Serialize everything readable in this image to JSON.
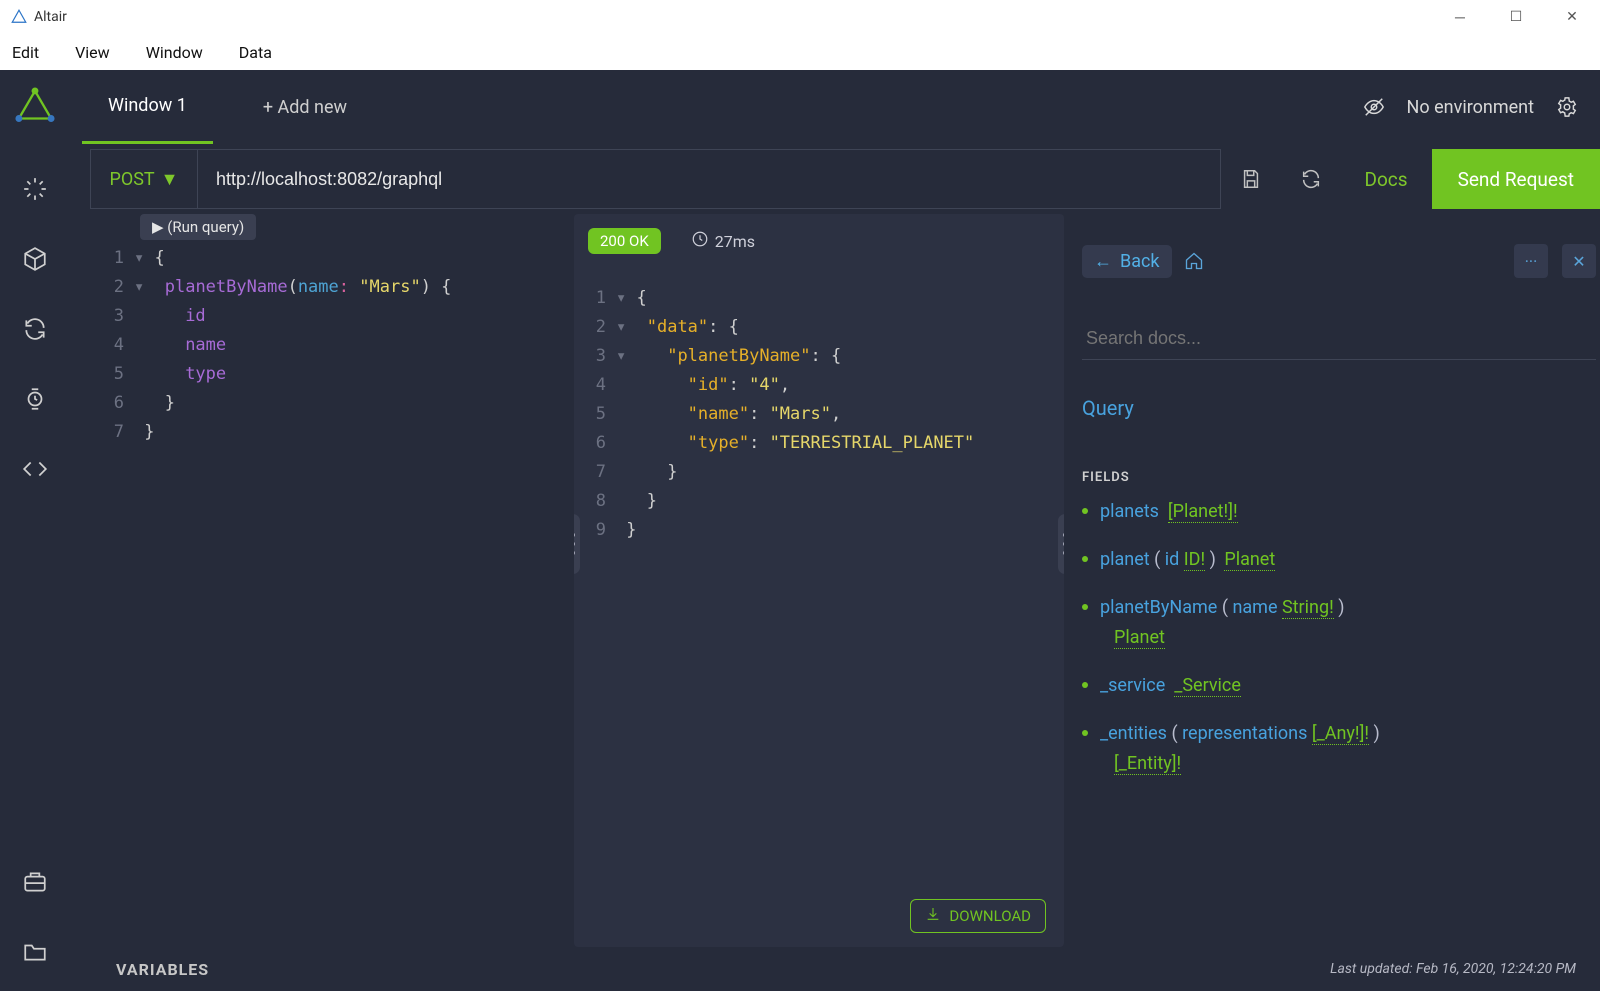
{
  "window": {
    "title": "Altair"
  },
  "menu": [
    "Edit",
    "View",
    "Window",
    "Data"
  ],
  "tabs": {
    "active": "Window 1",
    "add_label": "+ Add new"
  },
  "env": {
    "label": "No environment"
  },
  "request": {
    "method": "POST",
    "url": "http://localhost:8082/graphql",
    "docs_btn": "Docs",
    "send_btn": "Send Request",
    "run_badge": "▶ (Run query)"
  },
  "query_lines": [
    {
      "n": 1,
      "html": "<span class='caret'>▾</span><span class='tok-brace'> {</span>"
    },
    {
      "n": 2,
      "html": "<span class='caret'>▾</span>  <span class='tok-call'>planetByName</span><span class='tok-brace'>(</span><span class='tok-arg'>name</span><span class='tok-colon'>:</span> <span class='tok-str'>\"Mars\"</span><span class='tok-brace'>) {</span>"
    },
    {
      "n": 3,
      "html": "     <span class='tok-field'>id</span>"
    },
    {
      "n": 4,
      "html": "     <span class='tok-field'>name</span>"
    },
    {
      "n": 5,
      "html": "     <span class='tok-field'>type</span>"
    },
    {
      "n": 6,
      "html": "   <span class='tok-brace'>}</span>"
    },
    {
      "n": 7,
      "html": " <span class='tok-brace'>}</span>"
    }
  ],
  "response": {
    "status": "200 OK",
    "duration": "27ms",
    "download": "DOWNLOAD"
  },
  "response_lines": [
    {
      "n": 1,
      "html": "<span class='caret'>▾</span><span class='tok-brace'> {</span>"
    },
    {
      "n": 2,
      "html": "<span class='caret'>▾</span>  <span class='tok-key'>\"data\"</span>: <span class='tok-brace'>{</span>"
    },
    {
      "n": 3,
      "html": "<span class='caret'>▾</span>    <span class='tok-key'>\"planetByName\"</span>: <span class='tok-brace'>{</span>"
    },
    {
      "n": 4,
      "html": "       <span class='tok-key'>\"id\"</span>: <span class='tok-str'>\"4\"</span>,"
    },
    {
      "n": 5,
      "html": "       <span class='tok-key'>\"name\"</span>: <span class='tok-str'>\"Mars\"</span>,"
    },
    {
      "n": 6,
      "html": "       <span class='tok-key'>\"type\"</span>: <span class='tok-str'>\"TERRESTRIAL_PLANET\"</span>"
    },
    {
      "n": 7,
      "html": "     <span class='tok-brace'>}</span>"
    },
    {
      "n": 8,
      "html": "   <span class='tok-brace'>}</span>"
    },
    {
      "n": 9,
      "html": " <span class='tok-brace'>}</span>"
    }
  ],
  "docs": {
    "back": "Back",
    "search_placeholder": "Search docs...",
    "title": "Query",
    "fields_label": "FIELDS",
    "fields": [
      {
        "name": "planets",
        "args": [],
        "return": "[Planet!]!"
      },
      {
        "name": "planet",
        "args": [
          {
            "name": "id",
            "type": "ID!"
          }
        ],
        "return": "Planet"
      },
      {
        "name": "planetByName",
        "args": [
          {
            "name": "name",
            "type": "String!"
          }
        ],
        "return": "Planet"
      },
      {
        "name": "_service",
        "args": [],
        "return": "_Service"
      },
      {
        "name": "_entities",
        "args": [
          {
            "name": "representations",
            "type": "[_Any!]!"
          }
        ],
        "return": "[_Entity]!"
      }
    ]
  },
  "footer": {
    "variables": "VARIABLES",
    "updated": "Last updated: Feb 16, 2020, 12:24:20 PM"
  }
}
